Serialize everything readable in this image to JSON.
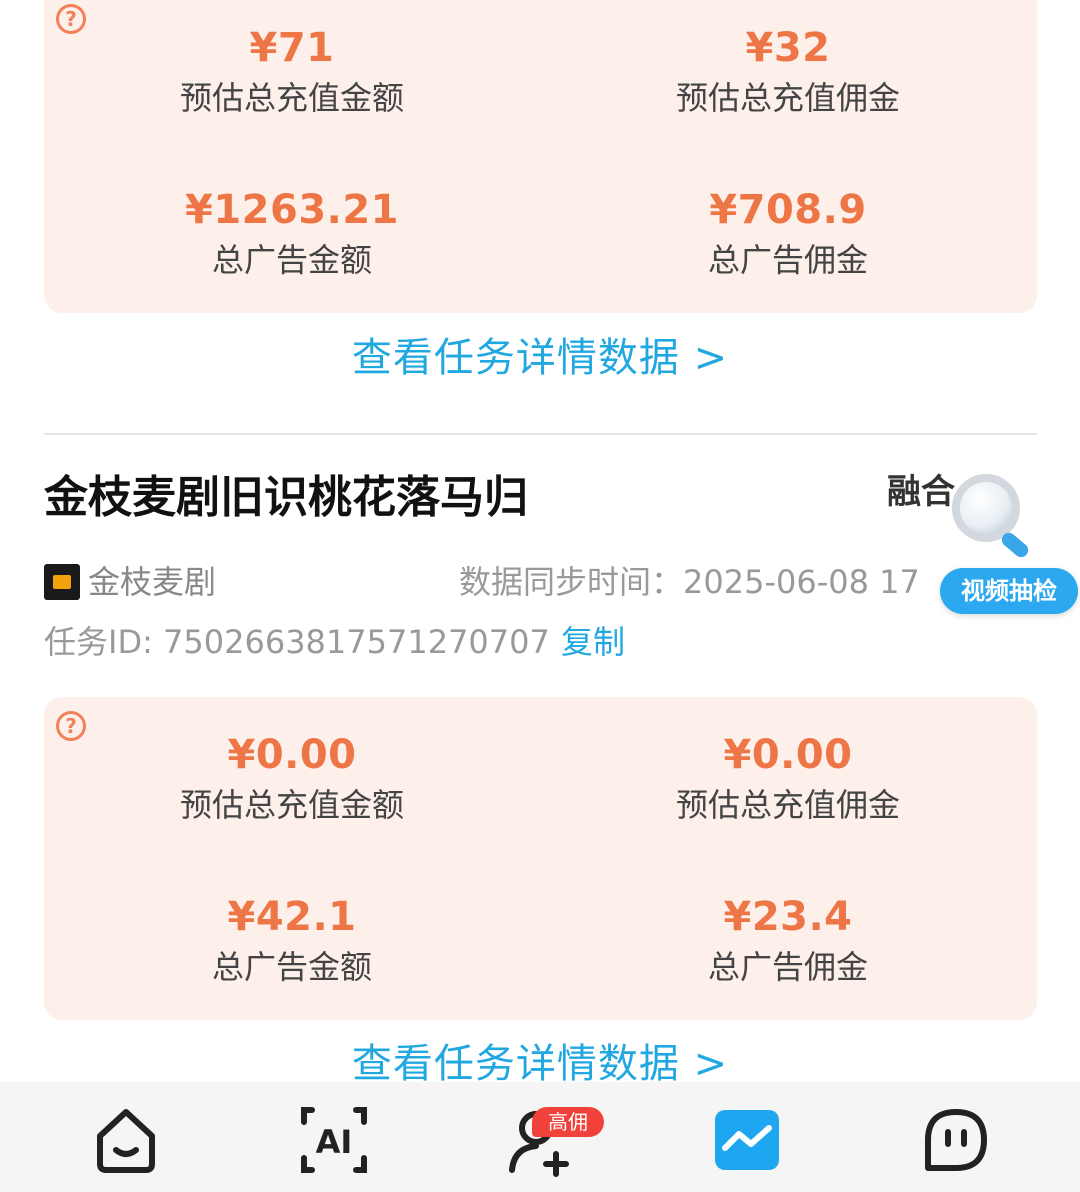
{
  "cards": [
    {
      "stats": [
        {
          "value": "¥71",
          "label": "预估总充值金额"
        },
        {
          "value": "¥32",
          "label": "预估总充值佣金"
        },
        {
          "value": "¥1263.21",
          "label": "总广告金额"
        },
        {
          "value": "¥708.9",
          "label": "总广告佣金"
        }
      ],
      "link": "查看任务详情数据 >"
    },
    {
      "stats": [
        {
          "value": "¥0.00",
          "label": "预估总充值金额"
        },
        {
          "value": "¥0.00",
          "label": "预估总充值佣金"
        },
        {
          "value": "¥42.1",
          "label": "总广告金额"
        },
        {
          "value": "¥23.4",
          "label": "总广告佣金"
        }
      ],
      "link": "查看任务详情数据 >"
    }
  ],
  "task": {
    "title": "金枝麦剧旧识桃花落马归",
    "type": "融合",
    "source": "金枝麦剧",
    "sync_label": "数据同步时间：",
    "sync_time": "2025-06-08 17",
    "id_text": "任务ID: 7502663817571270707",
    "copy_label": "复制"
  },
  "help_glyph": "?",
  "float_widget": {
    "label": "视频抽检",
    "icon": "magnifier-icon"
  },
  "tabbar": {
    "items": [
      {
        "icon": "home-icon"
      },
      {
        "icon": "ai-icon",
        "text": "AI"
      },
      {
        "icon": "add-user-icon",
        "badge": "高佣"
      },
      {
        "icon": "chart-icon",
        "active": true
      },
      {
        "icon": "message-icon"
      }
    ]
  },
  "colors": {
    "accent": "#ee7646",
    "link": "#21a8e0",
    "card_bg": "#fdf0ea",
    "active_tab": "#1ea7f0",
    "badge": "#f0423a"
  }
}
